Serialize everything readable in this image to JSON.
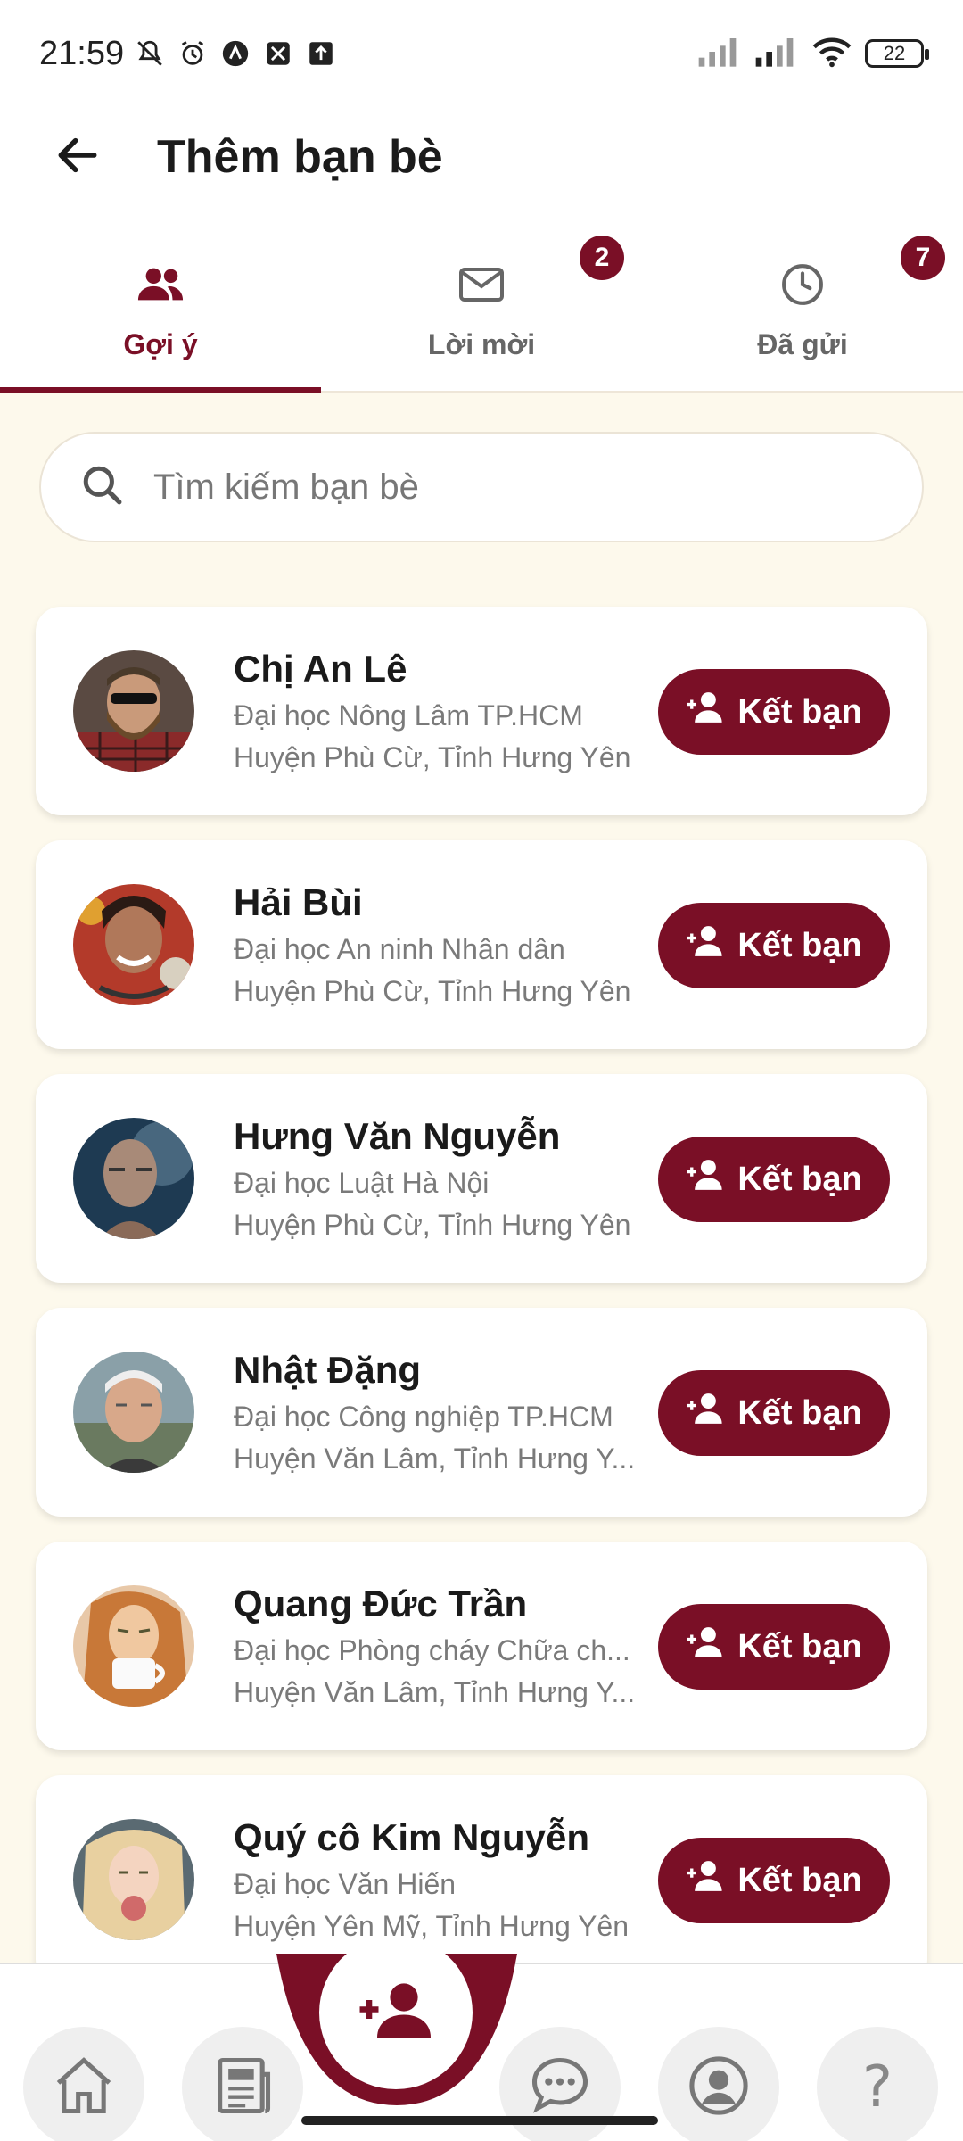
{
  "status_bar": {
    "time": "21:59",
    "battery": "22",
    "icons": [
      "mute-icon",
      "alarm-icon",
      "app-icon",
      "app-icon",
      "upload-icon",
      "signal-icon",
      "signal-icon",
      "wifi-icon",
      "battery-icon"
    ]
  },
  "header": {
    "title": "Thêm bạn bè",
    "back_icon": "arrow-left-icon"
  },
  "tabs": [
    {
      "label": "Gợi ý",
      "icon": "people-icon",
      "active": true,
      "badge": ""
    },
    {
      "label": "Lời mời",
      "icon": "mail-icon",
      "active": false,
      "badge": "2"
    },
    {
      "label": "Đã gửi",
      "icon": "clock-icon",
      "active": false,
      "badge": "7"
    }
  ],
  "search": {
    "placeholder": "Tìm kiếm bạn bè",
    "value": ""
  },
  "friends": [
    {
      "name": "Chị An Lê",
      "school": "Đại học Nông Lâm TP.HCM",
      "location": "Huyện Phù Cừ, Tỉnh Hưng Yên",
      "button": "Kết bạn"
    },
    {
      "name": "Hải Bùi",
      "school": "Đại học An ninh Nhân dân",
      "location": "Huyện Phù Cừ, Tỉnh Hưng Yên",
      "button": "Kết bạn"
    },
    {
      "name": "Hưng Văn Nguyễn",
      "school": "Đại học Luật Hà Nội",
      "location": "Huyện Phù Cừ, Tỉnh Hưng Yên",
      "button": "Kết bạn"
    },
    {
      "name": "Nhật Đặng",
      "school": "Đại học Công nghiệp TP.HCM",
      "location": "Huyện Văn Lâm, Tỉnh Hưng Y...",
      "button": "Kết bạn"
    },
    {
      "name": "Quang Đức Trần",
      "school": "Đại học Phòng cháy Chữa ch...",
      "location": "Huyện Văn Lâm, Tỉnh Hưng Y...",
      "button": "Kết bạn"
    },
    {
      "name": "Quý cô Kim Nguyễn",
      "school": "Đại học Văn Hiến",
      "location": "Huyện Yên Mỹ, Tỉnh Hưng Yên",
      "button": "Kết bạn"
    }
  ],
  "bottom_nav": [
    {
      "icon": "home-icon"
    },
    {
      "icon": "news-icon"
    },
    {
      "icon": "add-friend-icon",
      "active": true
    },
    {
      "icon": "chat-icon"
    },
    {
      "icon": "profile-icon"
    },
    {
      "icon": "help-icon",
      "label": "?"
    }
  ],
  "colors": {
    "accent": "#7a0f26",
    "background": "#fdf9ec"
  }
}
